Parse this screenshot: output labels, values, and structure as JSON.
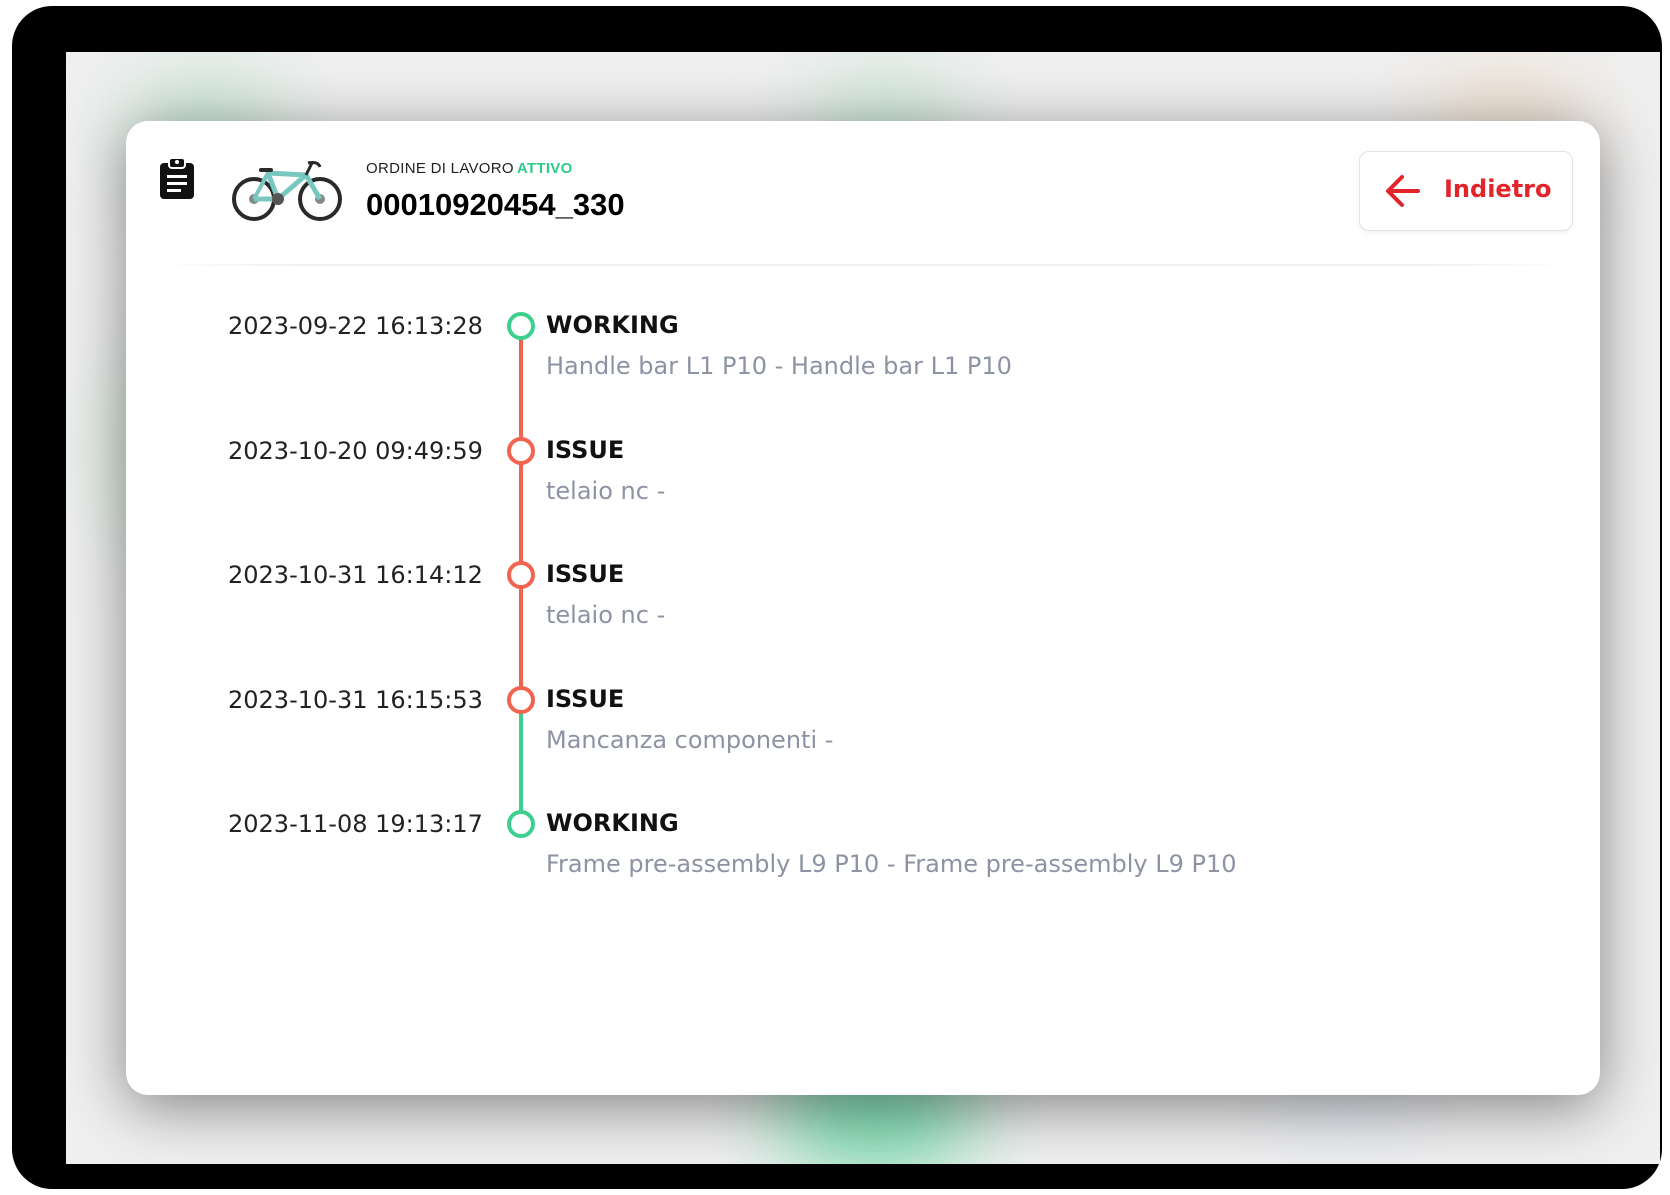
{
  "header": {
    "order_label": "ORDINE DI LAVORO",
    "order_status": "ATTIVO",
    "order_number": "00010920454_330",
    "back_label": "Indietro"
  },
  "colors": {
    "working": "#3ccf8e",
    "issue": "#f26350",
    "back": "#e3242b"
  },
  "icons": [
    "clipboard-icon",
    "bike-image",
    "arrow-left-icon"
  ],
  "events": [
    {
      "timestamp": "2023-09-22 16:13:28",
      "state": "WORKING",
      "description": "Handle bar L1 P10 - Handle bar L1 P10"
    },
    {
      "timestamp": "2023-10-20 09:49:59",
      "state": "ISSUE",
      "description": "telaio nc -"
    },
    {
      "timestamp": "2023-10-31 16:14:12",
      "state": "ISSUE",
      "description": "telaio nc -"
    },
    {
      "timestamp": "2023-10-31 16:15:53",
      "state": "ISSUE",
      "description": "Mancanza componenti -"
    },
    {
      "timestamp": "2023-11-08 19:13:17",
      "state": "WORKING",
      "description": "Frame pre-assembly L9 P10 - Frame pre-assembly L9 P10"
    }
  ]
}
